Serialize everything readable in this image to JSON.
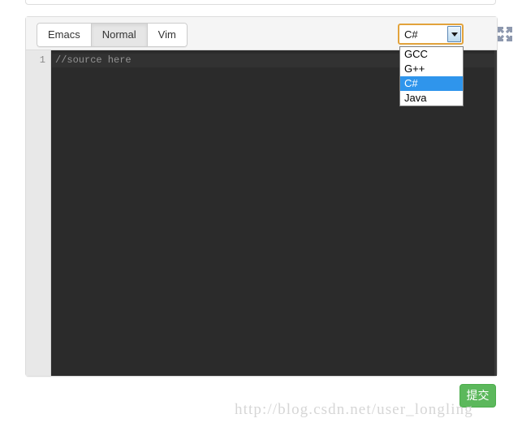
{
  "panel": {
    "editor_mode_buttons": [
      {
        "label": "Emacs",
        "active": false
      },
      {
        "label": "Normal",
        "active": true
      },
      {
        "label": "Vim",
        "active": false
      }
    ],
    "language_select": {
      "selected_value": "C#",
      "expanded": true,
      "options": [
        {
          "label": "GCC",
          "selected": false
        },
        {
          "label": "G++",
          "selected": false
        },
        {
          "label": "C#",
          "selected": true
        },
        {
          "label": "Java",
          "selected": false
        }
      ],
      "focus_outline_color": "#e2a33c",
      "highlight_color": "#2f95ec"
    },
    "fullscreen_icon_name": "fullscreen-expand-icon"
  },
  "code_editor": {
    "line_numbers": [
      "1"
    ],
    "lines": [
      "//source here"
    ],
    "background_color": "#2b2b2b",
    "gutter_color": "#e8e8e8",
    "text_color": "#949494"
  },
  "actions": {
    "submit_label": "提交",
    "submit_color": "#5cb85c"
  },
  "watermark": {
    "text": "http://blog.csdn.net/user_longling"
  }
}
